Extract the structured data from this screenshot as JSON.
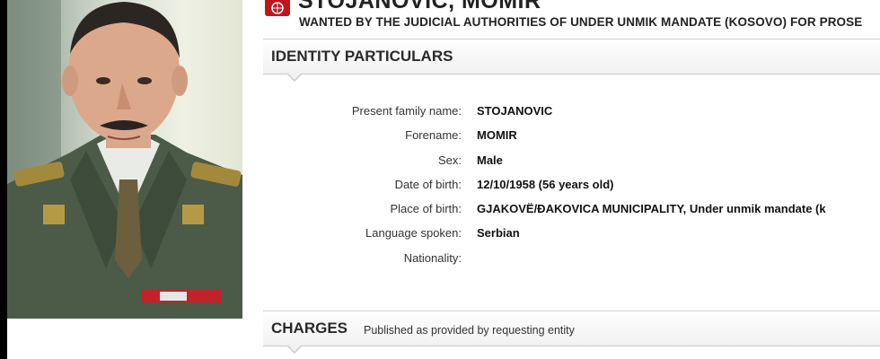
{
  "header": {
    "name": "STOJANOVIC, MOMIR",
    "wanted_by": "WANTED BY THE JUDICIAL AUTHORITIES OF UNDER UNMIK MANDATE (KOSOVO) FOR PROSE"
  },
  "identity": {
    "title": "IDENTITY PARTICULARS",
    "fields": [
      {
        "label": "Present family name:",
        "value": "STOJANOVIC"
      },
      {
        "label": "Forename:",
        "value": "MOMIR"
      },
      {
        "label": "Sex:",
        "value": "Male"
      },
      {
        "label": "Date of birth:",
        "value": "12/10/1958 (56 years old)"
      },
      {
        "label": "Place of birth:",
        "value": "GJAKOVË/ĐAKOVICA MUNICIPALITY, Under unmik mandate (k"
      },
      {
        "label": "Language spoken:",
        "value": "Serbian"
      },
      {
        "label": "Nationality:",
        "value": ""
      }
    ]
  },
  "charges": {
    "title": "CHARGES",
    "subtitle": "Published as provided by requesting entity"
  },
  "icons": {
    "logo": "interpol-logo-icon",
    "photo": "person-photo"
  },
  "colors": {
    "logo_red": "#c0151b",
    "section_border": "#c9c9c9"
  }
}
